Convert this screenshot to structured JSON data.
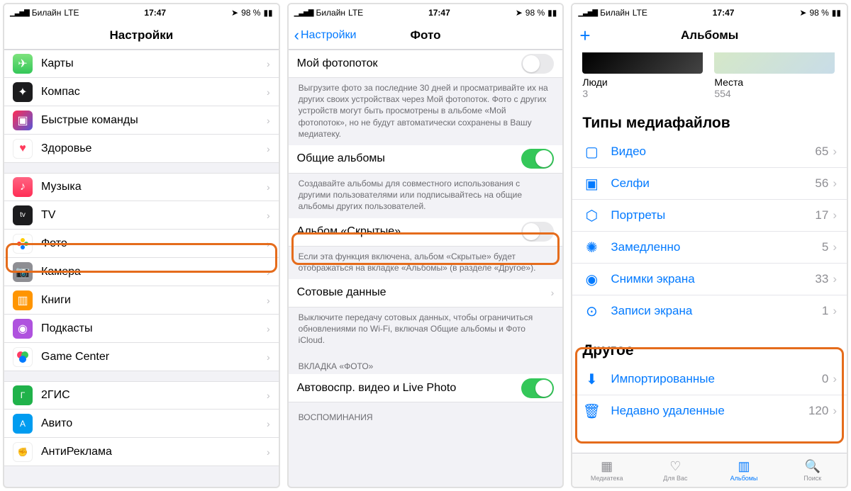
{
  "status": {
    "carrier": "Билайн",
    "net": "LTE",
    "time": "17:47",
    "battery": "98 %"
  },
  "phone1": {
    "title": "Настройки",
    "groupA": [
      {
        "label": "Карты",
        "bg": "#63d36a"
      },
      {
        "label": "Компас",
        "bg": "#1c1c1e"
      },
      {
        "label": "Быстрые команды",
        "bg": "#3a3a56"
      },
      {
        "label": "Здоровье",
        "bg": "#fff"
      }
    ],
    "groupB": [
      {
        "label": "Музыка",
        "bg": "#ff3b5c"
      },
      {
        "label": "TV",
        "bg": "#1c1c1e"
      },
      {
        "label": "Фото",
        "bg": "#fff"
      },
      {
        "label": "Камера",
        "bg": "#888"
      },
      {
        "label": "Книги",
        "bg": "#ff9500"
      },
      {
        "label": "Подкасты",
        "bg": "#9b59ff"
      },
      {
        "label": "Game Center",
        "bg": "#fff"
      }
    ],
    "groupC": [
      {
        "label": "2ГИС",
        "bg": "#20b24a"
      },
      {
        "label": "Авито",
        "bg": "#009cf0"
      },
      {
        "label": "АнтиРеклама",
        "bg": "#c53a2b"
      }
    ]
  },
  "phone2": {
    "back": "Настройки",
    "title": "Фото",
    "items": {
      "photostream": "Мой фотопоток",
      "photostream_desc": "Выгрузите фото за последние 30 дней и просматривайте их на других своих устройствах через Мой фотопоток. Фото с других устройств могут быть просмотрены в альбоме «Мой фотопоток», но не будут автоматически сохранены в Вашу медиатеку.",
      "shared": "Общие альбомы",
      "shared_desc": "Создавайте альбомы для совместного использования с другими пользователями или подписывайтесь на общие альбомы других пользователей.",
      "hidden": "Альбом «Скрытые»",
      "hidden_desc": "Если эта функция включена, альбом «Скрытые» будет отображаться на вкладке «Альбомы» (в разделе «Другое»).",
      "cellular": "Сотовые данные",
      "cellular_desc": "Выключите передачу сотовых данных, чтобы ограничиться обновлениями по Wi-Fi, включая Общие альбомы и Фото iCloud.",
      "tab_header": "ВКЛАДКА «ФОТО»",
      "autoplay": "Автовоспр. видео и Live Photo",
      "memories_header": "ВОСПОМИНАНИЯ"
    }
  },
  "phone3": {
    "title": "Альбомы",
    "top": {
      "people": "Люди",
      "people_count": "3",
      "places": "Места",
      "places_count": "554"
    },
    "section1": "Типы медиафайлов",
    "media": [
      {
        "label": "Видео",
        "count": "65"
      },
      {
        "label": "Селфи",
        "count": "56"
      },
      {
        "label": "Портреты",
        "count": "17"
      },
      {
        "label": "Замедленно",
        "count": "5"
      },
      {
        "label": "Снимки экрана",
        "count": "33"
      },
      {
        "label": "Записи экрана",
        "count": "1"
      }
    ],
    "section2": "Другое",
    "other": [
      {
        "label": "Импортированные",
        "count": "0"
      },
      {
        "label": "Недавно удаленные",
        "count": "120"
      }
    ],
    "tabs": [
      "Медиатека",
      "Для Вас",
      "Альбомы",
      "Поиск"
    ]
  }
}
